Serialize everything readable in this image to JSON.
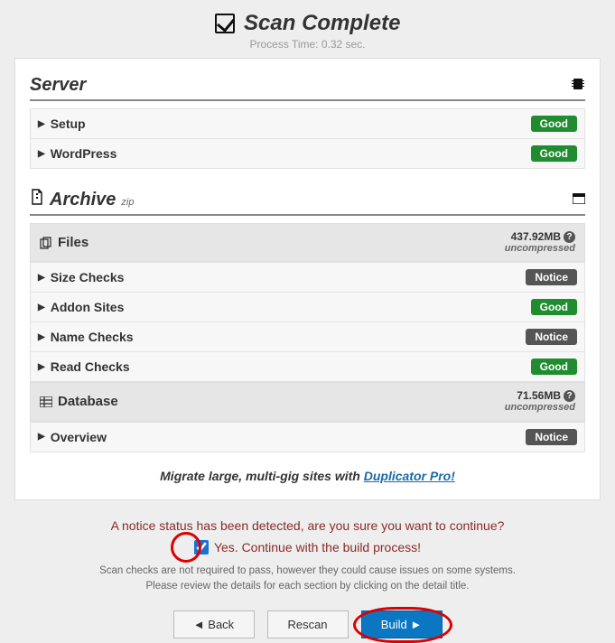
{
  "header": {
    "title": "Scan Complete",
    "subtitle": "Process Time: 0.32 sec."
  },
  "server": {
    "title": "Server",
    "rows": [
      {
        "label": "Setup",
        "status": "Good",
        "statusType": "good"
      },
      {
        "label": "WordPress",
        "status": "Good",
        "statusType": "good"
      }
    ]
  },
  "archive": {
    "title": "Archive",
    "format": "zip",
    "files": {
      "title": "Files",
      "size": "437.92MB",
      "note": "uncompressed"
    },
    "fileRows": [
      {
        "label": "Size Checks",
        "status": "Notice",
        "statusType": "notice"
      },
      {
        "label": "Addon Sites",
        "status": "Good",
        "statusType": "good"
      },
      {
        "label": "Name Checks",
        "status": "Notice",
        "statusType": "notice"
      },
      {
        "label": "Read Checks",
        "status": "Good",
        "statusType": "good"
      }
    ],
    "database": {
      "title": "Database",
      "size": "71.56MB",
      "note": "uncompressed"
    },
    "dbRows": [
      {
        "label": "Overview",
        "status": "Notice",
        "statusType": "notice"
      }
    ]
  },
  "promo": {
    "text": "Migrate large, multi-gig sites with ",
    "linkText": "Duplicator Pro!"
  },
  "notice": {
    "warning": "A notice status has been detected, are you sure you want to continue?",
    "confirmLabel": "Yes. Continue with the build process!",
    "hint1": "Scan checks are not required to pass, however they could cause issues on some systems.",
    "hint2": "Please review the details for each section by clicking on the detail title."
  },
  "buttons": {
    "back": "◄  Back",
    "rescan": "Rescan",
    "build": "Build  ►"
  }
}
